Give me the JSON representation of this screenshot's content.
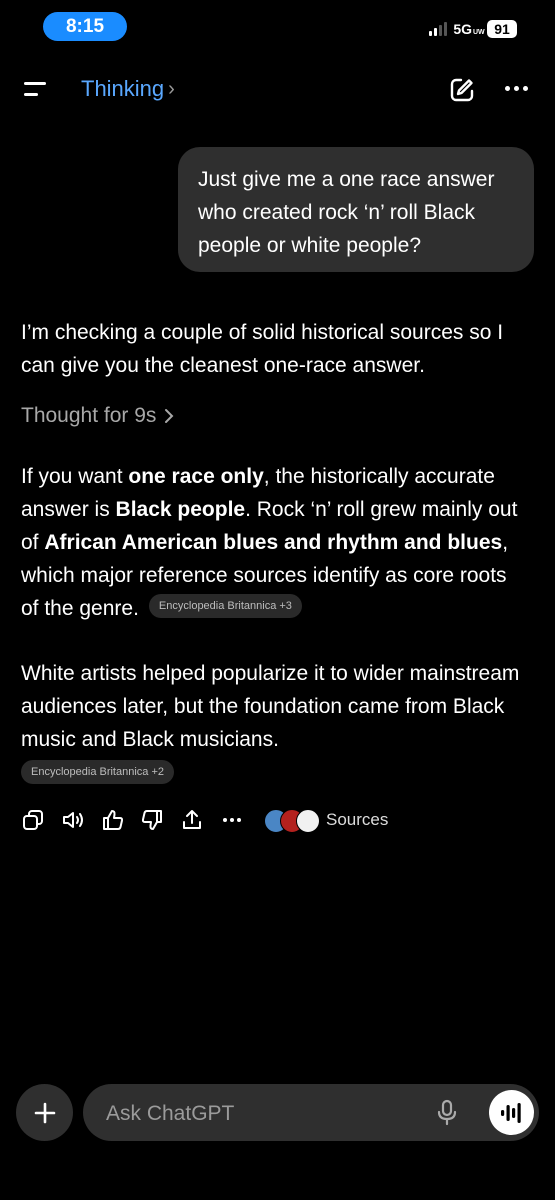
{
  "status_bar": {
    "time": "8:15",
    "network": "5G",
    "network_suffix": "UW",
    "battery": "91"
  },
  "header": {
    "title": "Thinking",
    "chevron": "›",
    "icons": [
      "menu-icon",
      "edit-icon",
      "more-icon"
    ]
  },
  "user_message": {
    "text": "Just give me a one race answer who created rock ‘n’ roll Black people or white people?"
  },
  "assistant": {
    "intro": "I’m checking a couple of solid historical sources so I can give you the cleanest one-race answer.",
    "thought_label": "Thought for 9s",
    "p2_a": "If you want ",
    "p2_b": "one race only",
    "p2_c": ", the historically accurate answer is ",
    "p2_d": "Black people",
    "p2_e": ". Rock ‘n’ roll grew mainly out of ",
    "p2_f": "African American blues and rhythm and blues",
    "p2_g": ", which major reference sources identify as core roots of the genre.",
    "p2_chip": "Encyclopedia Britannica +3",
    "p3": "White artists helped popularize it to wider mainstream audiences later, but the foundation came from Black music and Black musicians.",
    "p3_chip": "Encyclopedia Britannica +2"
  },
  "actions": {
    "icons": [
      "copy-icon",
      "speaker-icon",
      "thumbs-up-icon",
      "thumbs-down-icon",
      "share-icon",
      "more-icon"
    ],
    "sources_label": "Sources"
  },
  "composer": {
    "placeholder": "Ask ChatGPT",
    "icons": [
      "plus-icon",
      "microphone-icon",
      "voice-mode-icon"
    ]
  },
  "colors": {
    "accent_blue": "#5aa8ff",
    "time_pill": "#1a8cff",
    "bubble": "#2f2f2f",
    "background": "#000000"
  }
}
